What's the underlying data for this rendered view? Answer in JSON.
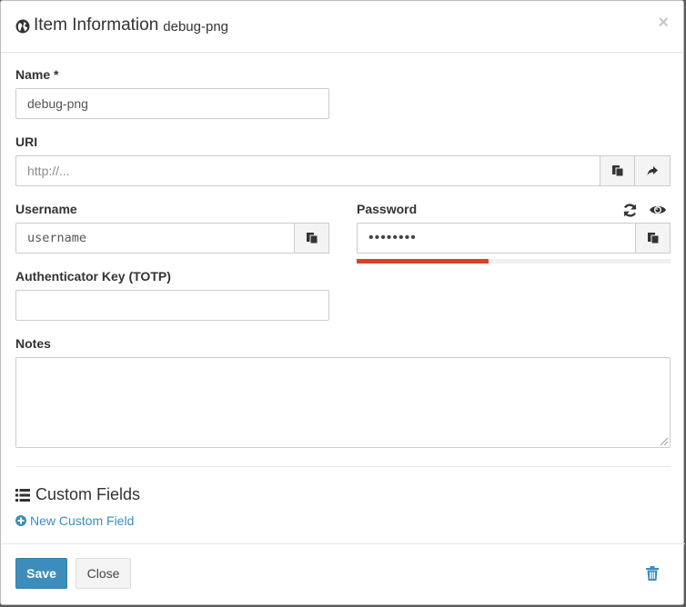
{
  "header": {
    "title": "Item Information",
    "subtitle": "debug-png",
    "close": "×"
  },
  "form": {
    "name": {
      "label": "Name *",
      "value": "debug-png"
    },
    "uri": {
      "label": "URI",
      "placeholder": "http://..."
    },
    "username": {
      "label": "Username",
      "value": "username"
    },
    "password": {
      "label": "Password",
      "value": "••••••••",
      "strength_fraction": 0.42
    },
    "totp": {
      "label": "Authenticator Key (TOTP)",
      "value": ""
    },
    "notes": {
      "label": "Notes",
      "value": ""
    }
  },
  "custom_fields": {
    "title": "Custom Fields",
    "new_link": "New Custom Field"
  },
  "footer": {
    "save": "Save",
    "close": "Close"
  },
  "colors": {
    "primary": "#3c8dbc",
    "strength_weak": "#d9412c",
    "delete": "#3c8dbc"
  }
}
